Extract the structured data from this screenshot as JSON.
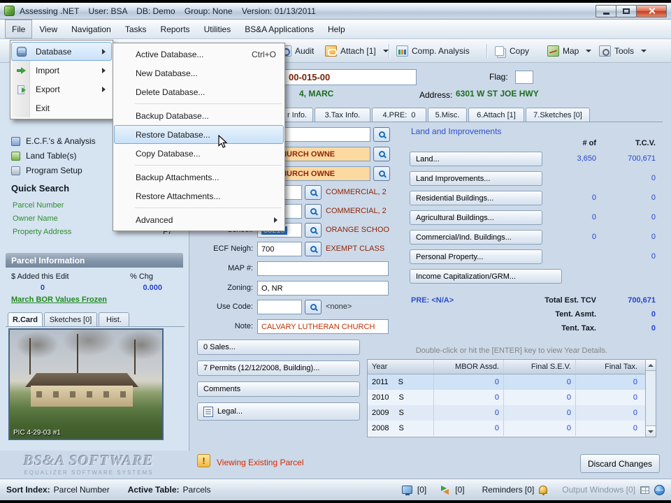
{
  "colors": {
    "accent_blue": "#2b50c8",
    "value_blue": "#2244cc",
    "value_green": "#1b6e1b",
    "value_maroon": "#8f2606",
    "status_red": "#d42a00",
    "link_green": "#2f8f2f"
  },
  "titlebar": {
    "title": "Assessing .NET    User: BSA    DB: Demo    Group: None    Version: 01/13/2011"
  },
  "menubar": {
    "items": [
      "File",
      "View",
      "Navigation",
      "Tasks",
      "Reports",
      "Utilities",
      "BS&A Applications",
      "Help"
    ]
  },
  "file_menu": {
    "items": [
      {
        "label": "Database"
      },
      {
        "label": "Import"
      },
      {
        "label": "Export"
      },
      {
        "label": "Exit"
      }
    ]
  },
  "database_menu": {
    "items": [
      {
        "label": "Active Database...",
        "shortcut": "Ctrl+O"
      },
      {
        "label": "New Database..."
      },
      {
        "label": "Delete Database..."
      },
      {
        "label": "Backup Database..."
      },
      {
        "label": "Restore Database..."
      },
      {
        "label": "Copy Database..."
      },
      {
        "label": "Backup Attachments..."
      },
      {
        "label": "Restore Attachments..."
      },
      {
        "label": "Advanced"
      }
    ]
  },
  "toolbar": {
    "audit": "Audit",
    "attach": "Attach [1]",
    "comp_analysis": "Comp. Analysis",
    "copy": "Copy",
    "map": "Map",
    "tools": "Tools"
  },
  "parcel_header": {
    "parcel_value": "00-015-00",
    "flag_label": "Flag:",
    "owner_value": "4, MARC",
    "address_label": "Address:",
    "address_value": "6301 W ST JOE HWY"
  },
  "tabs": {
    "items": [
      "r Info.",
      "3.Tax Info.",
      "4.PRE:  0",
      "5.Misc.",
      "6.Attach [1]",
      "7.Sketches [0]"
    ]
  },
  "sidebar": {
    "nav_items": [
      "E.C.F.'s & Analysis",
      "Land Table(s)",
      "Program Setup"
    ],
    "quick_search_title": "Quick Search",
    "links": [
      {
        "label": "Parcel Number",
        "key": ""
      },
      {
        "label": "Owner Name",
        "key": ""
      },
      {
        "label": "Property Address",
        "key": "F7"
      }
    ],
    "parcel_info_title": "Parcel Information",
    "added_label": "$ Added this Edit",
    "chg_label": "% Chg",
    "added_value": "0",
    "chg_value": "0.000",
    "frozen_note": "March BOR Values Frozen",
    "card_tabs": [
      "R.Card",
      "Sketches [0]",
      "Hist."
    ],
    "photo_caption": "PIC 4-29-03 #1",
    "watermark_line1": "BS&A SOFTWARE",
    "watermark_line2": "EQUALIZER SOFTWARE SYSTEMS"
  },
  "form": {
    "row2_value": "PT- CHURCH OWNE",
    "row3_value": "PT- CHURCH OWNE",
    "row4_right": "COMMERCIAL, 2",
    "row5_right": "COMMERCIAL, 2",
    "school_label": "School:",
    "school_value": "33215",
    "school_right": "ORANGE SCHOO",
    "ecf_label": "ECF Neigh:",
    "ecf_value": "700",
    "ecf_right": "EXEMPT CLASS",
    "map_label": "MAP #:",
    "zoning_label": "Zoning:",
    "zoning_value": "O, NR",
    "use_label": "Use Code:",
    "use_right": "<none>",
    "note_label": "Note:",
    "note_value": "CALVARY LUTHERAN CHURCH",
    "buttons": [
      "0 Sales...",
      "7 Permits (12/12/2008, Building)...",
      "Comments",
      "Legal..."
    ]
  },
  "land_panel": {
    "title": "Land and Improvements",
    "col_numof": "# of",
    "col_tcv": "T.C.V.",
    "rows": [
      {
        "label": "Land...",
        "numof": "3,650",
        "tcv": "700,671"
      },
      {
        "label": "Land Improvements...",
        "numof": "",
        "tcv": "0"
      },
      {
        "label": "Residential Buildings...",
        "numof": "0",
        "tcv": "0"
      },
      {
        "label": "Agricultural Buildings...",
        "numof": "0",
        "tcv": "0"
      },
      {
        "label": "Commercial/Ind. Buildings...",
        "numof": "0",
        "tcv": "0"
      },
      {
        "label": "Personal Property...",
        "numof": "",
        "tcv": "0"
      },
      {
        "label": "Income Capitalization/GRM...",
        "numof": "",
        "tcv": ""
      }
    ],
    "pre_value": "PRE: <N/A>",
    "total_label": "Total Est. TCV",
    "total_value": "700,671",
    "asmt_label": "Tent. Asmt.",
    "asmt_value": "0",
    "tax_label": "Tent. Tax.",
    "tax_value": "0"
  },
  "year_table": {
    "hint": "Double-click or hit the [ENTER] key to view Year Details.",
    "headers": [
      "Year",
      "MBOR Assd.",
      "Final S.E.V.",
      "Final Tax."
    ],
    "rows": [
      {
        "year": "2011",
        "status": "S",
        "mbor": "0",
        "sev": "0",
        "tax": "0"
      },
      {
        "year": "2010",
        "status": "S",
        "mbor": "0",
        "sev": "0",
        "tax": "0"
      },
      {
        "year": "2009",
        "status": "S",
        "mbor": "0",
        "sev": "0",
        "tax": "0"
      },
      {
        "year": "2008",
        "status": "S",
        "mbor": "0",
        "sev": "0",
        "tax": "0"
      }
    ]
  },
  "status_row": {
    "message": "Viewing Existing Parcel",
    "discard_button": "Discard Changes"
  },
  "statusbar": {
    "sort_index_label": "Sort Index:",
    "sort_index_value": "Parcel Number",
    "active_table_label": "Active Table:",
    "active_table_value": "Parcels",
    "badge1": "[0]",
    "badge2": "[0]",
    "reminders": "Reminders [0]",
    "output_windows": "Output Windows [0]"
  }
}
